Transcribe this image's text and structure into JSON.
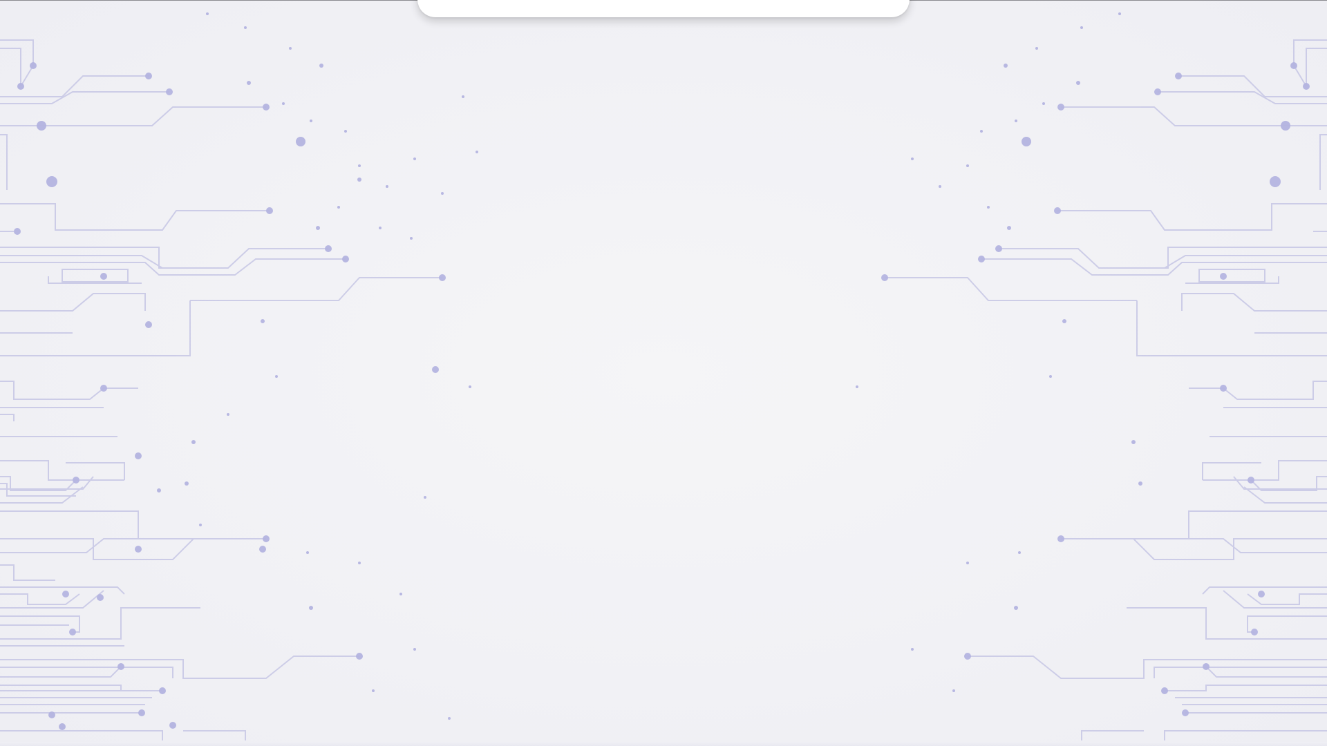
{
  "screen": {
    "background_color": "#f3f3f6",
    "pattern_color": "#c9c9e6",
    "pattern_dot_color": "#b4b4e0",
    "sheet_color": "#ffffff"
  },
  "decorations": {
    "left_pattern": "circuit-board-pattern",
    "right_pattern": "circuit-board-pattern"
  }
}
